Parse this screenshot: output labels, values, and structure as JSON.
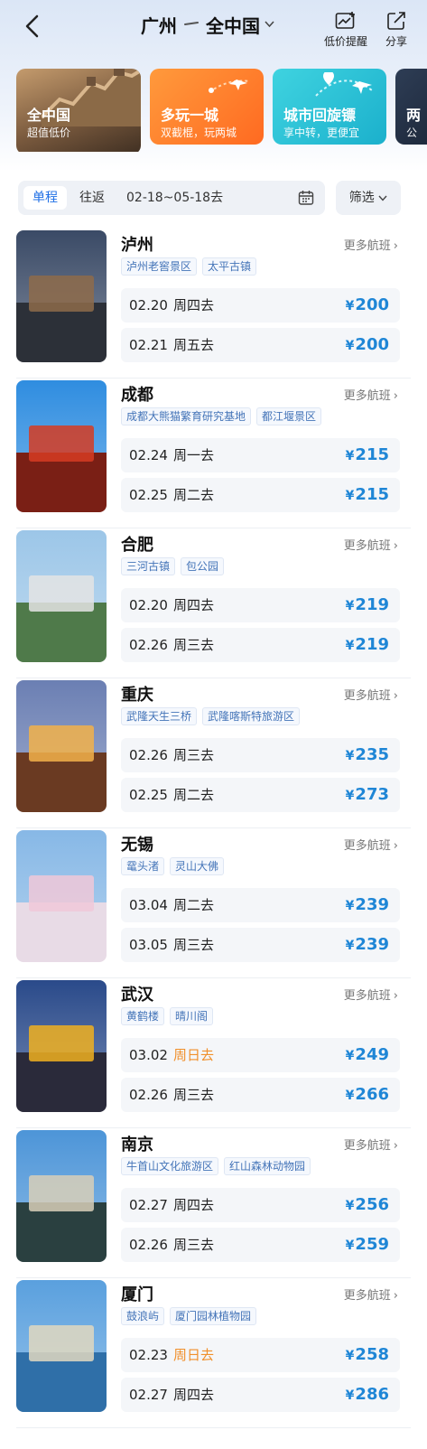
{
  "nav": {
    "origin": "广州",
    "destination": "全中国",
    "alert_label": "低价提醒",
    "share_label": "分享"
  },
  "promos": [
    {
      "title": "全中国",
      "subtitle": "超值低价"
    },
    {
      "title": "多玩一城",
      "subtitle": "双截棍，玩两城"
    },
    {
      "title": "城市回旋镖",
      "subtitle": "享中转，更便宜"
    },
    {
      "title": "两",
      "subtitle": "公"
    }
  ],
  "filter": {
    "one_way": "单程",
    "round_trip": "往返",
    "date_range": "02-18~05-18去",
    "screen_label": "筛选"
  },
  "more_label": "更多航班",
  "currency": "¥",
  "colors": {
    "accent": "#1f6fe6",
    "price": "#1f86d6",
    "weekend": "#f08f2a"
  },
  "destinations": [
    {
      "city": "泸州",
      "tags": [
        "泸州老窖景区",
        "太平古镇"
      ],
      "flights": [
        {
          "date": "02.20",
          "day": "周四去",
          "price": "200",
          "weekend": false
        },
        {
          "date": "02.21",
          "day": "周五去",
          "price": "200",
          "weekend": false
        }
      ]
    },
    {
      "city": "成都",
      "tags": [
        "成都大熊猫繁育研究基地",
        "都江堰景区"
      ],
      "flights": [
        {
          "date": "02.24",
          "day": "周一去",
          "price": "215",
          "weekend": false
        },
        {
          "date": "02.25",
          "day": "周二去",
          "price": "215",
          "weekend": false
        }
      ]
    },
    {
      "city": "合肥",
      "tags": [
        "三河古镇",
        "包公园"
      ],
      "flights": [
        {
          "date": "02.20",
          "day": "周四去",
          "price": "219",
          "weekend": false
        },
        {
          "date": "02.26",
          "day": "周三去",
          "price": "219",
          "weekend": false
        }
      ]
    },
    {
      "city": "重庆",
      "tags": [
        "武隆天生三桥",
        "武隆喀斯特旅游区"
      ],
      "flights": [
        {
          "date": "02.26",
          "day": "周三去",
          "price": "235",
          "weekend": false
        },
        {
          "date": "02.25",
          "day": "周二去",
          "price": "273",
          "weekend": false
        }
      ]
    },
    {
      "city": "无锡",
      "tags": [
        "鼋头渚",
        "灵山大佛"
      ],
      "flights": [
        {
          "date": "03.04",
          "day": "周二去",
          "price": "239",
          "weekend": false
        },
        {
          "date": "03.05",
          "day": "周三去",
          "price": "239",
          "weekend": false
        }
      ]
    },
    {
      "city": "武汉",
      "tags": [
        "黄鹤楼",
        "晴川阁"
      ],
      "flights": [
        {
          "date": "03.02",
          "day": "周日去",
          "price": "249",
          "weekend": true
        },
        {
          "date": "02.26",
          "day": "周三去",
          "price": "266",
          "weekend": false
        }
      ]
    },
    {
      "city": "南京",
      "tags": [
        "牛首山文化旅游区",
        "红山森林动物园"
      ],
      "flights": [
        {
          "date": "02.27",
          "day": "周四去",
          "price": "256",
          "weekend": false
        },
        {
          "date": "02.26",
          "day": "周三去",
          "price": "259",
          "weekend": false
        }
      ]
    },
    {
      "city": "厦门",
      "tags": [
        "鼓浪屿",
        "厦门园林植物园"
      ],
      "flights": [
        {
          "date": "02.23",
          "day": "周日去",
          "price": "258",
          "weekend": true
        },
        {
          "date": "02.27",
          "day": "周四去",
          "price": "286",
          "weekend": false
        }
      ]
    }
  ]
}
